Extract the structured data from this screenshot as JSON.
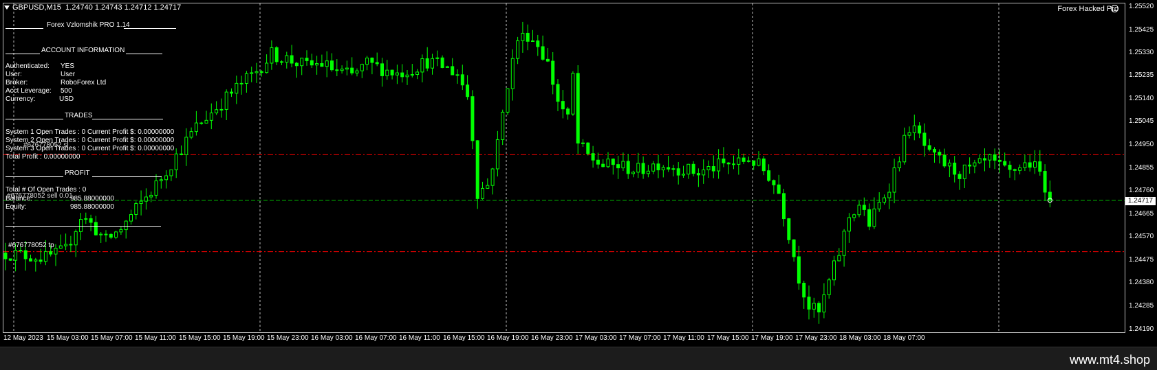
{
  "header": {
    "symbol": "GBPUSD,M15",
    "ohlc": "1.24740 1.24743 1.24712 1.24717"
  },
  "ea_name": "Forex Hacked Pro",
  "overlay": {
    "title_line": "Forex Vzlomshik PRO 1.14",
    "account_heading": "ACCOUNT INFORMATION",
    "account_rows": [
      {
        "label": "Authenticated:",
        "value": "YES"
      },
      {
        "label": "User:",
        "value": "User"
      },
      {
        "label": "Broker:",
        "value": "RoboForex Ltd"
      },
      {
        "label": "Acct Leverage:",
        "value": "500"
      },
      {
        "label": "Currency:",
        "value": "USD"
      }
    ],
    "trades_heading": "TRADES",
    "trade_rows": [
      "System 1 Open Trades :  0   Current Profit $:  0.00000000",
      "System 2 Open Trades :  0   Current Profit $:  0.00000000",
      "System 3 Open Trades :  0   Current Profit $:  0.00000000"
    ],
    "total_profit": "Total Profit       :  0.00000000",
    "profit_heading": "PROFIT",
    "open_trades_total": "Total # Of Open Trades :   0",
    "balance_label": "Balance:",
    "balance_value": "985.88000000",
    "equity_label": "Equity:",
    "equity_value": "985.88000000",
    "order_label_sl": "#676778052 sl",
    "order_label_sell": "#676778052 sell 0.01",
    "order_label_tp": "#676778052 tp"
  },
  "price_axis": [
    "1.25520",
    "1.25425",
    "1.25330",
    "1.25235",
    "1.25140",
    "1.25045",
    "1.24950",
    "1.24855",
    "1.24760",
    "1.24665",
    "1.24570",
    "1.24475",
    "1.24380",
    "1.24285",
    "1.24190"
  ],
  "current_price": "1.24717",
  "time_axis": [
    "12 May 2023",
    "15 May 03:00",
    "15 May 07:00",
    "15 May 11:00",
    "15 May 15:00",
    "15 May 19:00",
    "15 May 23:00",
    "16 May 03:00",
    "16 May 07:00",
    "16 May 11:00",
    "16 May 15:00",
    "16 May 19:00",
    "16 May 23:00",
    "17 May 03:00",
    "17 May 07:00",
    "17 May 11:00",
    "17 May 15:00",
    "17 May 19:00",
    "17 May 23:00",
    "18 May 03:00",
    "18 May 07:00"
  ],
  "footer": {
    "watermark": "www.mt4.shop"
  },
  "colors": {
    "background": "#000000",
    "candle": "#00ff00",
    "grid": "#c0c0c0",
    "sl_tp_line": "#ff0000",
    "bid_line": "#00c000"
  },
  "chart_data": {
    "type": "candlestick",
    "y_range": [
      1.2419,
      1.2552
    ],
    "levels": {
      "sl": 1.24905,
      "entry": 1.24717,
      "tp": 1.24505
    },
    "path": [
      [
        0,
        1.245
      ],
      [
        4,
        1.2449
      ],
      [
        8,
        1.2448
      ],
      [
        12,
        1.2451
      ],
      [
        15,
        1.2465
      ],
      [
        17,
        1.2462
      ],
      [
        20,
        1.2455
      ],
      [
        23,
        1.246
      ],
      [
        26,
        1.2468
      ],
      [
        30,
        1.2478
      ],
      [
        34,
        1.249
      ],
      [
        38,
        1.2502
      ],
      [
        42,
        1.251
      ],
      [
        46,
        1.2518
      ],
      [
        50,
        1.2525
      ],
      [
        53,
        1.2532
      ],
      [
        56,
        1.253
      ],
      [
        60,
        1.2527
      ],
      [
        63,
        1.2528
      ],
      [
        66,
        1.2525
      ],
      [
        69,
        1.2523
      ],
      [
        72,
        1.2528
      ],
      [
        75,
        1.2526
      ],
      [
        78,
        1.2524
      ],
      [
        81,
        1.2526
      ],
      [
        84,
        1.2529
      ],
      [
        87,
        1.2527
      ],
      [
        90,
        1.2524
      ],
      [
        92,
        1.2515
      ],
      [
        93,
        1.2498
      ],
      [
        94,
        1.2475
      ],
      [
        96,
        1.2478
      ],
      [
        98,
        1.2495
      ],
      [
        100,
        1.252
      ],
      [
        102,
        1.2538
      ],
      [
        104,
        1.254
      ],
      [
        106,
        1.2536
      ],
      [
        108,
        1.2528
      ],
      [
        110,
        1.2513
      ],
      [
        112,
        1.2505
      ],
      [
        113,
        1.2523
      ],
      [
        114,
        1.2495
      ],
      [
        116,
        1.249
      ],
      [
        119,
        1.2486
      ],
      [
        122,
        1.2486
      ],
      [
        126,
        1.2484
      ],
      [
        130,
        1.2487
      ],
      [
        134,
        1.2485
      ],
      [
        138,
        1.2483
      ],
      [
        142,
        1.2486
      ],
      [
        146,
        1.2487
      ],
      [
        148,
        1.2489
      ],
      [
        150,
        1.2486
      ],
      [
        152,
        1.2482
      ],
      [
        154,
        1.2475
      ],
      [
        156,
        1.2458
      ],
      [
        158,
        1.244
      ],
      [
        160,
        1.2428
      ],
      [
        162,
        1.2425
      ],
      [
        164,
        1.2438
      ],
      [
        166,
        1.245
      ],
      [
        168,
        1.2465
      ],
      [
        170,
        1.247
      ],
      [
        172,
        1.2462
      ],
      [
        174,
        1.247
      ],
      [
        176,
        1.2478
      ],
      [
        178,
        1.249
      ],
      [
        180,
        1.2502
      ],
      [
        182,
        1.2498
      ],
      [
        184,
        1.249
      ],
      [
        186,
        1.2488
      ],
      [
        188,
        1.2485
      ],
      [
        190,
        1.2483
      ],
      [
        193,
        1.2485
      ],
      [
        196,
        1.2488
      ],
      [
        198,
        1.2485
      ],
      [
        200,
        1.2483
      ],
      [
        202,
        1.2486
      ],
      [
        204,
        1.2487
      ],
      [
        206,
        1.2483
      ],
      [
        207,
        1.2478
      ],
      [
        208,
        1.24717
      ]
    ]
  }
}
